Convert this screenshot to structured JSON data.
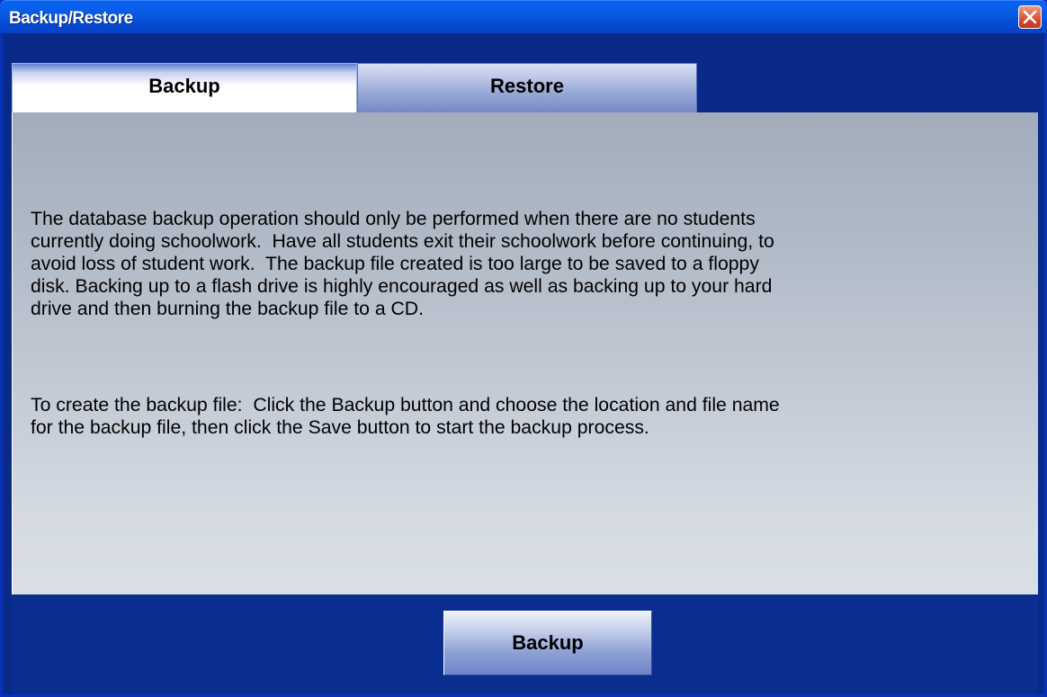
{
  "window": {
    "title": "Backup/Restore"
  },
  "tabs": [
    {
      "label": "Backup",
      "selected": true
    },
    {
      "label": "Restore",
      "selected": false
    }
  ],
  "content": {
    "paragraph1": "The database backup operation should only be performed when there are no students\ncurrently doing schoolwork.  Have all students exit their schoolwork before continuing, to\navoid loss of student work.  The backup file created is too large to be saved to a floppy\ndisk. Backing up to a flash drive is highly encouraged as well as backing up to your hard\ndrive and then burning the backup file to a CD.",
    "paragraph2": "To create the backup file:  Click the Backup button and choose the location and file name\nfor the backup file, then click the Save button to start the backup process."
  },
  "footer": {
    "backup_button_label": "Backup"
  },
  "colors": {
    "titlebar": "#0758e0",
    "frame": "#0a2a8a",
    "close": "#cf4528"
  },
  "icons": {
    "close": "close-icon"
  }
}
